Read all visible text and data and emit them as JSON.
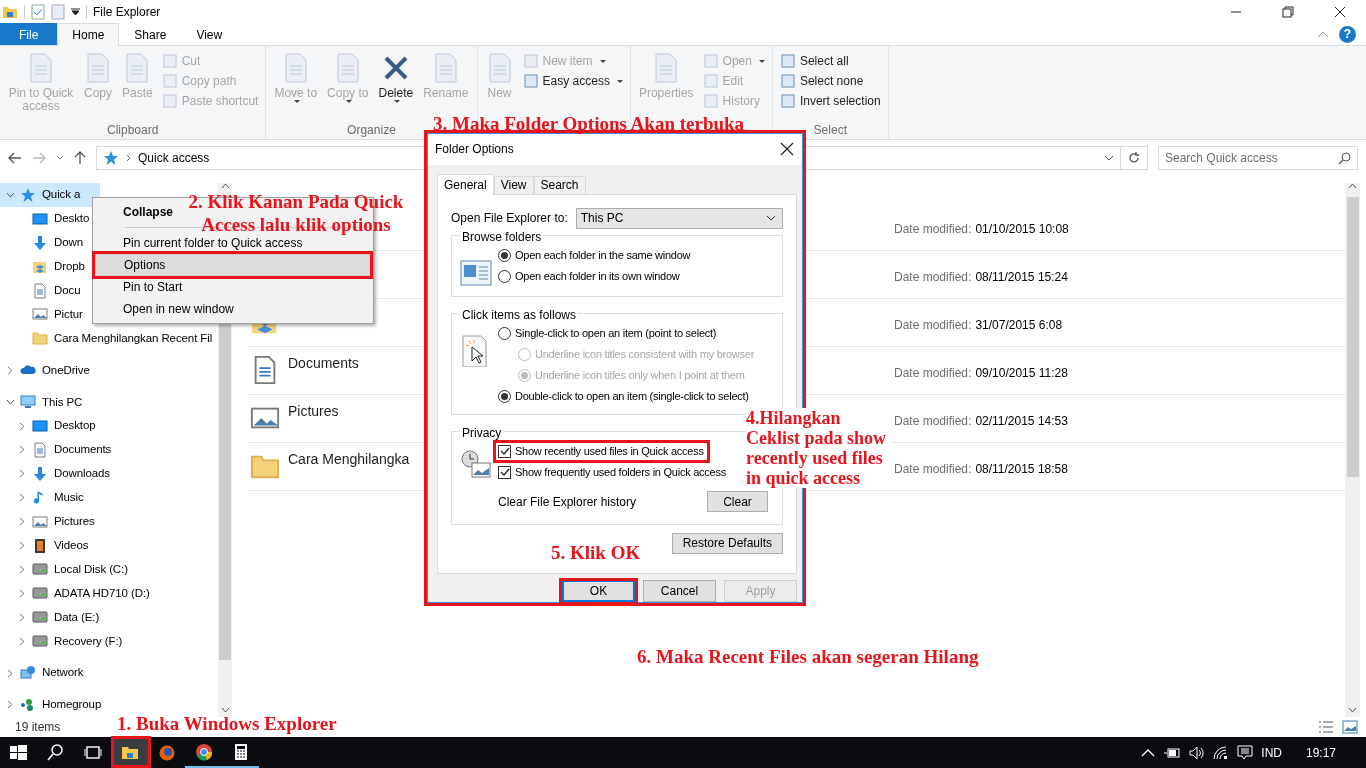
{
  "window": {
    "title": "File Explorer"
  },
  "ribbon": {
    "tabs": [
      {
        "label": "File",
        "kind": "file",
        "selected": false
      },
      {
        "label": "Home",
        "kind": "tab",
        "selected": true
      },
      {
        "label": "Share",
        "kind": "tab",
        "selected": false
      },
      {
        "label": "View",
        "kind": "tab",
        "selected": false
      }
    ],
    "help": "?",
    "groups": [
      {
        "label": "Clipboard",
        "buttons": [
          {
            "label": "Pin to Quick access",
            "kind": "large",
            "disabled": true,
            "dropdown": false
          },
          {
            "label": "Copy",
            "kind": "large",
            "disabled": true,
            "dropdown": false
          },
          {
            "label": "Paste",
            "kind": "large",
            "disabled": true,
            "dropdown": false
          },
          {
            "label": "Cut",
            "kind": "small",
            "disabled": true,
            "dropdown": false
          },
          {
            "label": "Copy path",
            "kind": "small",
            "disabled": true,
            "dropdown": false
          },
          {
            "label": "Paste shortcut",
            "kind": "small",
            "disabled": true,
            "dropdown": false
          }
        ]
      },
      {
        "label": "Organize",
        "buttons": [
          {
            "label": "Move to",
            "kind": "large",
            "disabled": true,
            "dropdown": true
          },
          {
            "label": "Copy to",
            "kind": "large",
            "disabled": true,
            "dropdown": true
          },
          {
            "label": "Delete",
            "kind": "delete",
            "disabled": false,
            "dropdown": true
          },
          {
            "label": "Rename",
            "kind": "large",
            "disabled": true,
            "dropdown": false
          }
        ]
      },
      {
        "buttons": [
          {
            "label": "New",
            "kind": "large",
            "disabled": true,
            "dropdown": false
          },
          {
            "label": "New item",
            "kind": "small",
            "disabled": true,
            "dropdown": true
          },
          {
            "label": "Easy access",
            "kind": "small",
            "disabled": false,
            "dropdown": true
          }
        ]
      },
      {
        "buttons": [
          {
            "label": "Properties",
            "kind": "large",
            "disabled": true,
            "dropdown": false
          },
          {
            "label": "Open",
            "kind": "small",
            "disabled": true,
            "dropdown": true
          },
          {
            "label": "Edit",
            "kind": "small",
            "disabled": true,
            "dropdown": false
          },
          {
            "label": "History",
            "kind": "small",
            "disabled": true,
            "dropdown": false
          }
        ]
      },
      {
        "label": "Select",
        "buttons": [
          {
            "label": "Select all",
            "kind": "small",
            "disabled": false,
            "dropdown": false
          },
          {
            "label": "Select none",
            "kind": "small",
            "disabled": false,
            "dropdown": false
          },
          {
            "label": "Invert selection",
            "kind": "small",
            "disabled": false,
            "dropdown": false
          }
        ]
      }
    ]
  },
  "address": {
    "path": "Quick access",
    "search_placeholder": "Search Quick access"
  },
  "navigation": [
    {
      "label": "Quick a",
      "kind": "star",
      "expanded": true,
      "selected": true,
      "children": [
        {
          "label": "Deskto",
          "kind": "desktop",
          "selected": false
        },
        {
          "label": "Down",
          "kind": "download",
          "selected": false
        },
        {
          "label": "Dropb",
          "kind": "dropbox",
          "selected": false
        },
        {
          "label": "Docu",
          "kind": "document",
          "selected": false
        },
        {
          "label": "Pictur",
          "kind": "picture",
          "selected": false
        },
        {
          "label": "Cara Menghilangkan Recent Fil",
          "kind": "folder",
          "selected": false
        }
      ]
    },
    {
      "label": "OneDrive",
      "kind": "cloud",
      "expanded": false,
      "selected": false
    },
    {
      "label": "This PC",
      "kind": "pc",
      "expanded": true,
      "selected": false,
      "children": [
        {
          "label": "Desktop",
          "kind": "desktop",
          "expanded": false,
          "selected": false
        },
        {
          "label": "Documents",
          "kind": "document",
          "expanded": false,
          "selected": false
        },
        {
          "label": "Downloads",
          "kind": "download",
          "expanded": false,
          "selected": false
        },
        {
          "label": "Music",
          "kind": "music",
          "expanded": false,
          "selected": false
        },
        {
          "label": "Pictures",
          "kind": "picture",
          "expanded": false,
          "selected": false
        },
        {
          "label": "Videos",
          "kind": "video",
          "expanded": false,
          "selected": false
        },
        {
          "label": "Local Disk (C:)",
          "kind": "drive",
          "expanded": false,
          "selected": false
        },
        {
          "label": "ADATA HD710 (D:)",
          "kind": "drive",
          "expanded": false,
          "selected": false
        },
        {
          "label": "Data (E:)",
          "kind": "drive",
          "expanded": false,
          "selected": false
        },
        {
          "label": "Recovery (F:)",
          "kind": "drive",
          "expanded": false,
          "selected": false
        }
      ]
    },
    {
      "label": "Network",
      "kind": "network",
      "expanded": false,
      "selected": false
    },
    {
      "label": "Homegroup",
      "kind": "homegroup",
      "expanded": false,
      "selected": false
    }
  ],
  "folders": [
    {
      "date_label": "Date modified:",
      "date": "01/10/2015 10:08"
    },
    {
      "date_label": "Date modified:",
      "date": "08/11/2015 15:24"
    },
    {
      "kind": "dropbox",
      "date_label": "Date modified:",
      "date": "31/07/2015 6:08"
    },
    {
      "kind": "document",
      "name": "Documents",
      "date_label": "Date modified:",
      "date": "09/10/2015 11:28"
    },
    {
      "kind": "picture",
      "name": "Pictures",
      "date_label": "Date modified:",
      "date": "02/11/2015 14:53"
    },
    {
      "kind": "folder",
      "name": "Cara Menghilangka",
      "date_label": "Date modified:",
      "date": "08/11/2015 18:58"
    }
  ],
  "status_bar": {
    "count": "19 items"
  },
  "context_menu": {
    "items": [
      {
        "label": "Collapse",
        "bold": true,
        "selected": false
      },
      {
        "label": "Pin current folder to Quick access",
        "bold": false,
        "selected": false
      },
      {
        "label": "Options",
        "bold": false,
        "selected": true
      },
      {
        "label": "Pin to Start",
        "bold": false,
        "selected": false
      },
      {
        "label": "Open in new window",
        "bold": false,
        "selected": false
      }
    ]
  },
  "dialog": {
    "title": "Folder Options",
    "tabs": [
      {
        "label": "General",
        "selected": true
      },
      {
        "label": "View",
        "selected": false
      },
      {
        "label": "Search",
        "selected": false
      }
    ],
    "open_to": {
      "label": "Open File Explorer to:",
      "value": "This PC"
    },
    "groups": [
      {
        "title": "Browse folders",
        "kind": "browse",
        "options": [
          {
            "kind": "radio",
            "label": "Open each folder in the same window",
            "selected": true,
            "disabled": false
          },
          {
            "kind": "radio",
            "label": "Open each folder in its own window",
            "selected": false,
            "disabled": false
          }
        ]
      },
      {
        "title": "Click items as follows",
        "kind": "click",
        "options": [
          {
            "kind": "radio",
            "label": "Single-click to open an item (point to select)",
            "selected": false,
            "disabled": false,
            "children": [
              {
                "kind": "radio",
                "label": "Underline icon titles consistent with my browser",
                "selected": false,
                "disabled": true
              },
              {
                "kind": "radio",
                "label": "Underline icon titles only when I point at them",
                "selected": true,
                "disabled": true
              }
            ]
          },
          {
            "kind": "radio",
            "label": "Double-click to open an item (single-click to select)",
            "selected": true,
            "disabled": false
          }
        ]
      },
      {
        "title": "Privacy",
        "kind": "privacy",
        "options": [
          {
            "kind": "checkbox",
            "label": "Show recently used files in Quick access",
            "checked": true
          },
          {
            "kind": "checkbox",
            "label": "Show frequently used folders in Quick access",
            "checked": true
          },
          {
            "kind": "action",
            "label": "Clear File Explorer history",
            "button": "Clear"
          }
        ]
      }
    ],
    "restore_button": "Restore Defaults",
    "buttons": [
      {
        "label": "OK",
        "default": true,
        "disabled": false
      },
      {
        "label": "Cancel",
        "default": false,
        "disabled": false
      },
      {
        "label": "Apply",
        "default": false,
        "disabled": true
      }
    ]
  },
  "annotations": [
    "1. Buka Windows Explorer",
    "2. Klik Kanan Pada Quick Access lalu klik options",
    "3. Maka Folder Options Akan terbuka",
    "4.Hilangkan Ceklist pada show recently used files in quick access",
    "5. Klik OK",
    "6. Maka Recent Files akan segeran Hilang"
  ],
  "taskbar": {
    "items": [
      {
        "kind": "start",
        "active": false,
        "running": false
      },
      {
        "kind": "search",
        "active": false,
        "running": false
      },
      {
        "kind": "taskview",
        "active": false,
        "running": false
      },
      {
        "kind": "explorer",
        "active": true,
        "running": false
      },
      {
        "kind": "firefox",
        "active": false,
        "running": false
      },
      {
        "kind": "chrome",
        "active": false,
        "running": true
      },
      {
        "kind": "calculator",
        "active": false,
        "running": true
      }
    ],
    "language": "IND",
    "time": "19:17"
  }
}
